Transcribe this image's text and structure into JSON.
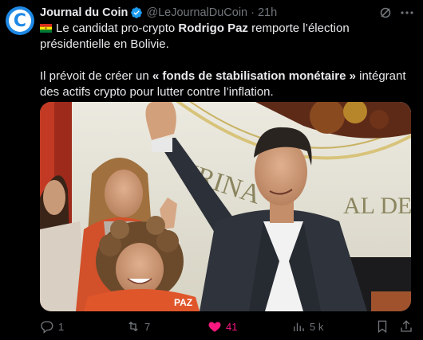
{
  "author": {
    "name": "Journal du Coin",
    "handle": "@LeJournalDuCoin",
    "separator": "·",
    "time": "21h"
  },
  "tweet": {
    "line1_pre": "Le candidat pro-crypto ",
    "line1_bold": "Rodrigo Paz",
    "line1_post": " remporte l’élection présidentielle en Bolivie.",
    "line2_pre": "Il prévoit de créer un ",
    "line2_bold": "« fonds de stabilisation monétaire »",
    "line2_post": " intégrant des actifs crypto pour lutter contre l’inflation."
  },
  "photo": {
    "backdrop_text": "URINA",
    "backdrop_text2": "AL DE",
    "vest_text": "PAZ"
  },
  "actions": {
    "replies": "1",
    "reposts": "7",
    "likes": "41",
    "views": "5 k"
  },
  "colors": {
    "background": "#000000",
    "text": "#e7e9ea",
    "muted": "#71767b",
    "like": "#f91880",
    "verified": "#1d9bf0",
    "avatar": "#1e88e5"
  }
}
